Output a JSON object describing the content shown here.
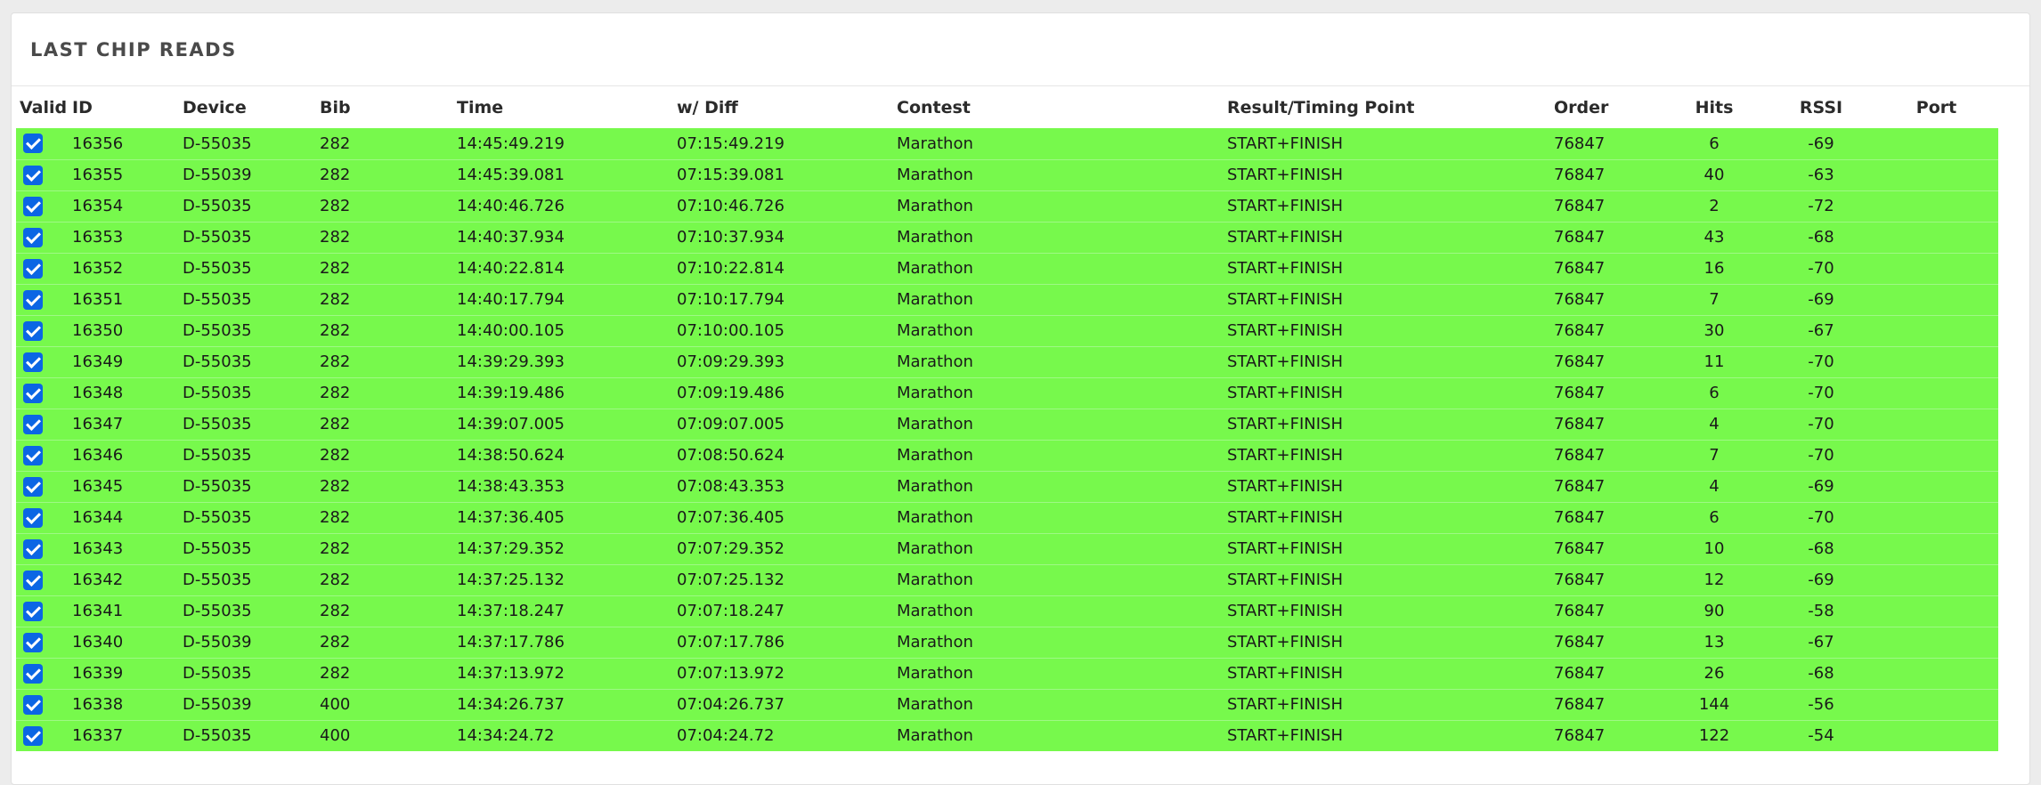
{
  "panel": {
    "title": "LAST CHIP READS"
  },
  "columns": [
    "Valid",
    "ID",
    "Device",
    "Bib",
    "Time",
    "w/ Diff",
    "Contest",
    "Result/Timing Point",
    "Order",
    "Hits",
    "RSSI",
    "Port"
  ],
  "rows": [
    {
      "valid": true,
      "id": "16356",
      "device": "D-55035",
      "bib": "282",
      "time": "14:45:49.219",
      "diff": "07:15:49.219",
      "contest": "Marathon",
      "result": "START+FINISH",
      "order": "76847",
      "hits": "6",
      "rssi": "-69",
      "port": ""
    },
    {
      "valid": true,
      "id": "16355",
      "device": "D-55039",
      "bib": "282",
      "time": "14:45:39.081",
      "diff": "07:15:39.081",
      "contest": "Marathon",
      "result": "START+FINISH",
      "order": "76847",
      "hits": "40",
      "rssi": "-63",
      "port": ""
    },
    {
      "valid": true,
      "id": "16354",
      "device": "D-55035",
      "bib": "282",
      "time": "14:40:46.726",
      "diff": "07:10:46.726",
      "contest": "Marathon",
      "result": "START+FINISH",
      "order": "76847",
      "hits": "2",
      "rssi": "-72",
      "port": ""
    },
    {
      "valid": true,
      "id": "16353",
      "device": "D-55035",
      "bib": "282",
      "time": "14:40:37.934",
      "diff": "07:10:37.934",
      "contest": "Marathon",
      "result": "START+FINISH",
      "order": "76847",
      "hits": "43",
      "rssi": "-68",
      "port": ""
    },
    {
      "valid": true,
      "id": "16352",
      "device": "D-55035",
      "bib": "282",
      "time": "14:40:22.814",
      "diff": "07:10:22.814",
      "contest": "Marathon",
      "result": "START+FINISH",
      "order": "76847",
      "hits": "16",
      "rssi": "-70",
      "port": ""
    },
    {
      "valid": true,
      "id": "16351",
      "device": "D-55035",
      "bib": "282",
      "time": "14:40:17.794",
      "diff": "07:10:17.794",
      "contest": "Marathon",
      "result": "START+FINISH",
      "order": "76847",
      "hits": "7",
      "rssi": "-69",
      "port": ""
    },
    {
      "valid": true,
      "id": "16350",
      "device": "D-55035",
      "bib": "282",
      "time": "14:40:00.105",
      "diff": "07:10:00.105",
      "contest": "Marathon",
      "result": "START+FINISH",
      "order": "76847",
      "hits": "30",
      "rssi": "-67",
      "port": ""
    },
    {
      "valid": true,
      "id": "16349",
      "device": "D-55035",
      "bib": "282",
      "time": "14:39:29.393",
      "diff": "07:09:29.393",
      "contest": "Marathon",
      "result": "START+FINISH",
      "order": "76847",
      "hits": "11",
      "rssi": "-70",
      "port": ""
    },
    {
      "valid": true,
      "id": "16348",
      "device": "D-55035",
      "bib": "282",
      "time": "14:39:19.486",
      "diff": "07:09:19.486",
      "contest": "Marathon",
      "result": "START+FINISH",
      "order": "76847",
      "hits": "6",
      "rssi": "-70",
      "port": ""
    },
    {
      "valid": true,
      "id": "16347",
      "device": "D-55035",
      "bib": "282",
      "time": "14:39:07.005",
      "diff": "07:09:07.005",
      "contest": "Marathon",
      "result": "START+FINISH",
      "order": "76847",
      "hits": "4",
      "rssi": "-70",
      "port": ""
    },
    {
      "valid": true,
      "id": "16346",
      "device": "D-55035",
      "bib": "282",
      "time": "14:38:50.624",
      "diff": "07:08:50.624",
      "contest": "Marathon",
      "result": "START+FINISH",
      "order": "76847",
      "hits": "7",
      "rssi": "-70",
      "port": ""
    },
    {
      "valid": true,
      "id": "16345",
      "device": "D-55035",
      "bib": "282",
      "time": "14:38:43.353",
      "diff": "07:08:43.353",
      "contest": "Marathon",
      "result": "START+FINISH",
      "order": "76847",
      "hits": "4",
      "rssi": "-69",
      "port": ""
    },
    {
      "valid": true,
      "id": "16344",
      "device": "D-55035",
      "bib": "282",
      "time": "14:37:36.405",
      "diff": "07:07:36.405",
      "contest": "Marathon",
      "result": "START+FINISH",
      "order": "76847",
      "hits": "6",
      "rssi": "-70",
      "port": ""
    },
    {
      "valid": true,
      "id": "16343",
      "device": "D-55035",
      "bib": "282",
      "time": "14:37:29.352",
      "diff": "07:07:29.352",
      "contest": "Marathon",
      "result": "START+FINISH",
      "order": "76847",
      "hits": "10",
      "rssi": "-68",
      "port": ""
    },
    {
      "valid": true,
      "id": "16342",
      "device": "D-55035",
      "bib": "282",
      "time": "14:37:25.132",
      "diff": "07:07:25.132",
      "contest": "Marathon",
      "result": "START+FINISH",
      "order": "76847",
      "hits": "12",
      "rssi": "-69",
      "port": ""
    },
    {
      "valid": true,
      "id": "16341",
      "device": "D-55035",
      "bib": "282",
      "time": "14:37:18.247",
      "diff": "07:07:18.247",
      "contest": "Marathon",
      "result": "START+FINISH",
      "order": "76847",
      "hits": "90",
      "rssi": "-58",
      "port": ""
    },
    {
      "valid": true,
      "id": "16340",
      "device": "D-55039",
      "bib": "282",
      "time": "14:37:17.786",
      "diff": "07:07:17.786",
      "contest": "Marathon",
      "result": "START+FINISH",
      "order": "76847",
      "hits": "13",
      "rssi": "-67",
      "port": ""
    },
    {
      "valid": true,
      "id": "16339",
      "device": "D-55035",
      "bib": "282",
      "time": "14:37:13.972",
      "diff": "07:07:13.972",
      "contest": "Marathon",
      "result": "START+FINISH",
      "order": "76847",
      "hits": "26",
      "rssi": "-68",
      "port": ""
    },
    {
      "valid": true,
      "id": "16338",
      "device": "D-55039",
      "bib": "400",
      "time": "14:34:26.737",
      "diff": "07:04:26.737",
      "contest": "Marathon",
      "result": "START+FINISH",
      "order": "76847",
      "hits": "144",
      "rssi": "-56",
      "port": ""
    },
    {
      "valid": true,
      "id": "16337",
      "device": "D-55035",
      "bib": "400",
      "time": "14:34:24.72",
      "diff": "07:04:24.72",
      "contest": "Marathon",
      "result": "START+FINISH",
      "order": "76847",
      "hits": "122",
      "rssi": "-54",
      "port": ""
    }
  ],
  "colors": {
    "row_valid": "#77f94c",
    "checkbox": "#0b66e4"
  }
}
